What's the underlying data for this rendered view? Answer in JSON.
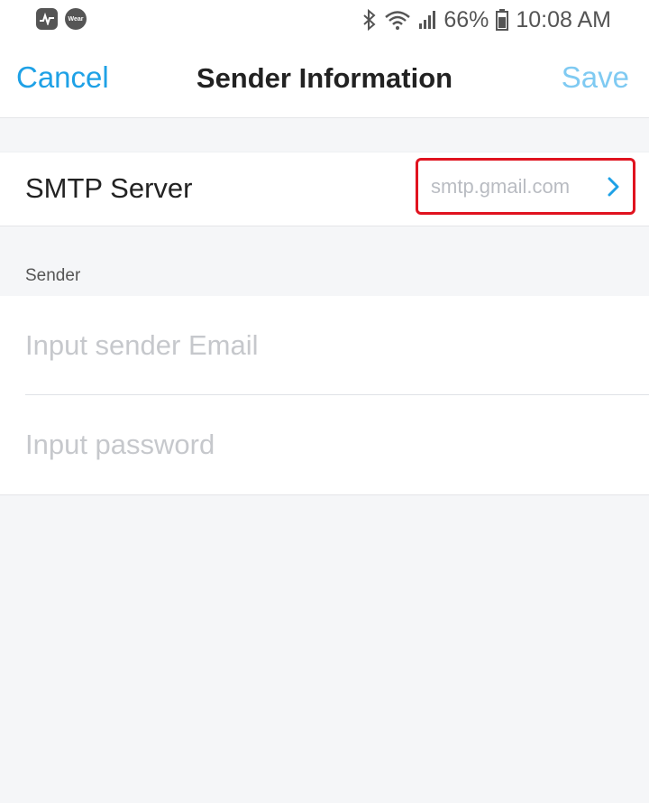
{
  "status_bar": {
    "battery": "66%",
    "time": "10:08 AM",
    "wear_label": "Wear",
    "icons": [
      "activity-icon",
      "wear-app-icon",
      "bluetooth-icon",
      "wifi-icon",
      "signal-icon",
      "battery-icon"
    ]
  },
  "nav": {
    "cancel_label": "Cancel",
    "title": "Sender Information",
    "save_label": "Save"
  },
  "smtp": {
    "label": "SMTP Server",
    "value": "smtp.gmail.com"
  },
  "sender": {
    "section_label": "Sender",
    "email_placeholder": "Input sender Email",
    "email_value": "",
    "password_placeholder": "Input password",
    "password_value": ""
  },
  "colors": {
    "accent": "#1ea1e6",
    "save_disabled": "#7fcaf2",
    "highlight_border": "#e0131f",
    "background": "#f5f6f8"
  }
}
